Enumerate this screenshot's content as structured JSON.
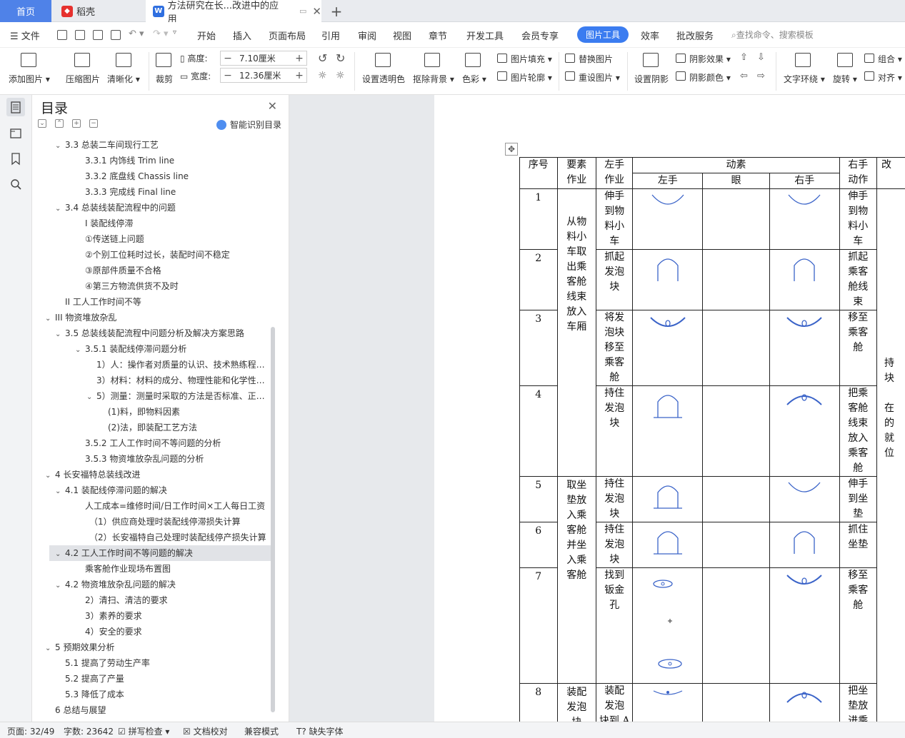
{
  "tabs": {
    "home": "首页",
    "daoke": "稻壳",
    "doc": "方法研究在长...改进中的应用"
  },
  "menubar": {
    "file": "文件",
    "items": [
      "开始",
      "插入",
      "页面布局",
      "引用",
      "审阅",
      "视图",
      "章节",
      "开发工具",
      "会员专享"
    ],
    "active": "图片工具",
    "after": [
      "效率",
      "批改服务"
    ],
    "search": "查找命令、搜索模板"
  },
  "ribbon": {
    "add_image": "添加图片",
    "compress": "压缩图片",
    "clarify": "清晰化",
    "crop": "裁剪",
    "height_label": "高度:",
    "height_value": "7.10厘米",
    "width_label": "宽度:",
    "width_value": "12.36厘米",
    "transparent": "设置透明色",
    "remove_bg": "抠除背景",
    "color": "色彩",
    "fill": "图片填充",
    "outline": "图片轮廓",
    "replace": "替换图片",
    "reset": "重设图片",
    "shadow": "设置阴影",
    "shadow_effect": "阴影效果",
    "shadow_color": "阴影颜色",
    "wrap": "文字环绕",
    "rotate": "旋转",
    "group": "组合",
    "align": "对齐"
  },
  "toc": {
    "title": "目录",
    "ai_label": "智能识别目录",
    "items": [
      {
        "text": "3.3 总装二车间现行工艺",
        "level": 2,
        "caret": "v"
      },
      {
        "text": "3.3.1 内饰线  Trim line",
        "level": 3
      },
      {
        "text": "3.3.2 底盘线  Chassis line",
        "level": 3
      },
      {
        "text": "3.3.3 完成线  Final line",
        "level": 3
      },
      {
        "text": "3.4 总装线装配流程中的问题",
        "level": 2,
        "caret": "v"
      },
      {
        "text": "I 装配线停滞",
        "level": 3
      },
      {
        "text": "①传送链上问题",
        "level": 3
      },
      {
        "text": "②个别工位耗时过长，装配时间不稳定",
        "level": 3
      },
      {
        "text": "③原部件质量不合格",
        "level": 3
      },
      {
        "text": "④第三方物流供货不及时",
        "level": 3
      },
      {
        "text": "II 工人工作时间不等",
        "level": 2
      },
      {
        "text": "III 物资堆放杂乱",
        "level": 1,
        "caret": "v"
      },
      {
        "text": "3.5 总装线装配流程中问题分析及解决方案思路",
        "level": 2,
        "caret": "v"
      },
      {
        "text": "3.5.1 装配线停滞问题分析",
        "level": 3,
        "caret": "v"
      },
      {
        "text": "1）人：操作者对质量的认识、技术熟练程度 ...",
        "level": 4
      },
      {
        "text": "3）材料：材料的成分、物理性能和化学性能 ...",
        "level": 4
      },
      {
        "text": "5）测量：测量时采取的方法是否标准、正确 ...",
        "level": 4,
        "caret": "v"
      },
      {
        "text": "(1)料，即物料因素",
        "level": 5
      },
      {
        "text": "(2)法，即装配工艺方法",
        "level": 5
      },
      {
        "text": "3.5.2 工人工作时间不等问题的分析",
        "level": 3
      },
      {
        "text": "3.5.3 物资堆放杂乱问题的分析",
        "level": 3
      },
      {
        "text": "4  长安福特总装线改进",
        "level": 1,
        "caret": "v"
      },
      {
        "text": "4.1 装配线停滞问题的解决",
        "level": 2,
        "caret": "v"
      },
      {
        "text": "人工成本=维修时间/日工作时间×工人每日工资",
        "level": 3
      },
      {
        "text": "（1）供应商处理时装配线停滞损失计算",
        "level": 3.5
      },
      {
        "text": "（2）长安福特自己处理时装配线停产损失计算",
        "level": 3.5
      },
      {
        "text": "4.2 工人工作时间不等问题的解决",
        "level": 2,
        "caret": "v",
        "selected": true
      },
      {
        "text": "乘客舱作业现场布置图",
        "level": 3
      },
      {
        "text": "4.2 物资堆放杂乱问题的解决",
        "level": 2,
        "caret": "v"
      },
      {
        "text": "2）清扫、清洁的要求",
        "level": 3
      },
      {
        "text": "3）素养的要求",
        "level": 3
      },
      {
        "text": "4）安全的要求",
        "level": 3
      },
      {
        "text": "5  预期效果分析",
        "level": 1,
        "caret": "v"
      },
      {
        "text": "5.1 提高了劳动生产率",
        "level": 2
      },
      {
        "text": "5.2 提高了产量",
        "level": 2
      },
      {
        "text": "5.3 降低了成本",
        "level": 2
      },
      {
        "text": "6  总结与展望",
        "level": 1
      }
    ]
  },
  "table": {
    "h_seq": "序号",
    "h_elem": [
      "要素",
      "作业"
    ],
    "h_left": [
      "左手",
      "作业"
    ],
    "h_motion": "动素",
    "h_lefthand": "左手",
    "h_eye": "眼",
    "h_righthand": "右手",
    "h_right": [
      "右手",
      "动作"
    ],
    "h_last": "改",
    "rows": [
      {
        "n": "1",
        "lw": [
          "伸手",
          "到物",
          "料小",
          "车"
        ],
        "rw": [
          "伸手",
          "到物",
          "料小",
          "车"
        ]
      },
      {
        "n": "2",
        "lw": [
          "抓起",
          "发泡",
          "块"
        ],
        "rw": [
          "抓起",
          "乘客",
          "舱线",
          "束"
        ]
      },
      {
        "n": "3",
        "lw": [
          "将发",
          "泡块",
          "移至",
          "乘客",
          "舱"
        ],
        "rw": [
          "移至",
          "乘客",
          "舱"
        ]
      },
      {
        "n": "4",
        "lw": [
          "持住",
          "发泡",
          "块"
        ],
        "rw": [
          "把乘",
          "客舱",
          "线束",
          "放入",
          "乘客",
          "舱"
        ]
      },
      {
        "n": "5",
        "lw": [
          "持住",
          "发泡",
          "块"
        ],
        "rw": [
          "伸手",
          "到坐",
          "垫"
        ]
      },
      {
        "n": "6",
        "lw": [
          "持住",
          "发泡",
          "块"
        ],
        "rw": [
          "抓住",
          "坐垫"
        ]
      },
      {
        "n": "7",
        "lw": [
          "找到",
          "钣金",
          "孔"
        ],
        "rw": [
          "移至",
          "乘客",
          "舱"
        ]
      },
      {
        "n": "8",
        "lw": [
          "装配",
          "发泡",
          "块到 A"
        ],
        "rw": [
          "把坐",
          "垫放",
          "进乘"
        ]
      }
    ],
    "elem1": [
      "从物",
      "料小",
      "车取",
      "出乘",
      "客舱",
      "线束",
      "放入",
      "车厢"
    ],
    "elem2": [
      "取坐",
      "垫放",
      "入乘",
      "客舱",
      "并坐",
      "入乘",
      "客舱"
    ],
    "elem3": [
      "装配",
      "发泡",
      "块"
    ],
    "last": [
      "持",
      "块",
      "",
      "在",
      "的",
      "就",
      "位"
    ]
  },
  "status": {
    "page": "页面: 32/49",
    "words": "字数: 23642",
    "spell": "拼写检查",
    "proof": "文档校对",
    "compat": "兼容模式",
    "font": "缺失字体"
  }
}
